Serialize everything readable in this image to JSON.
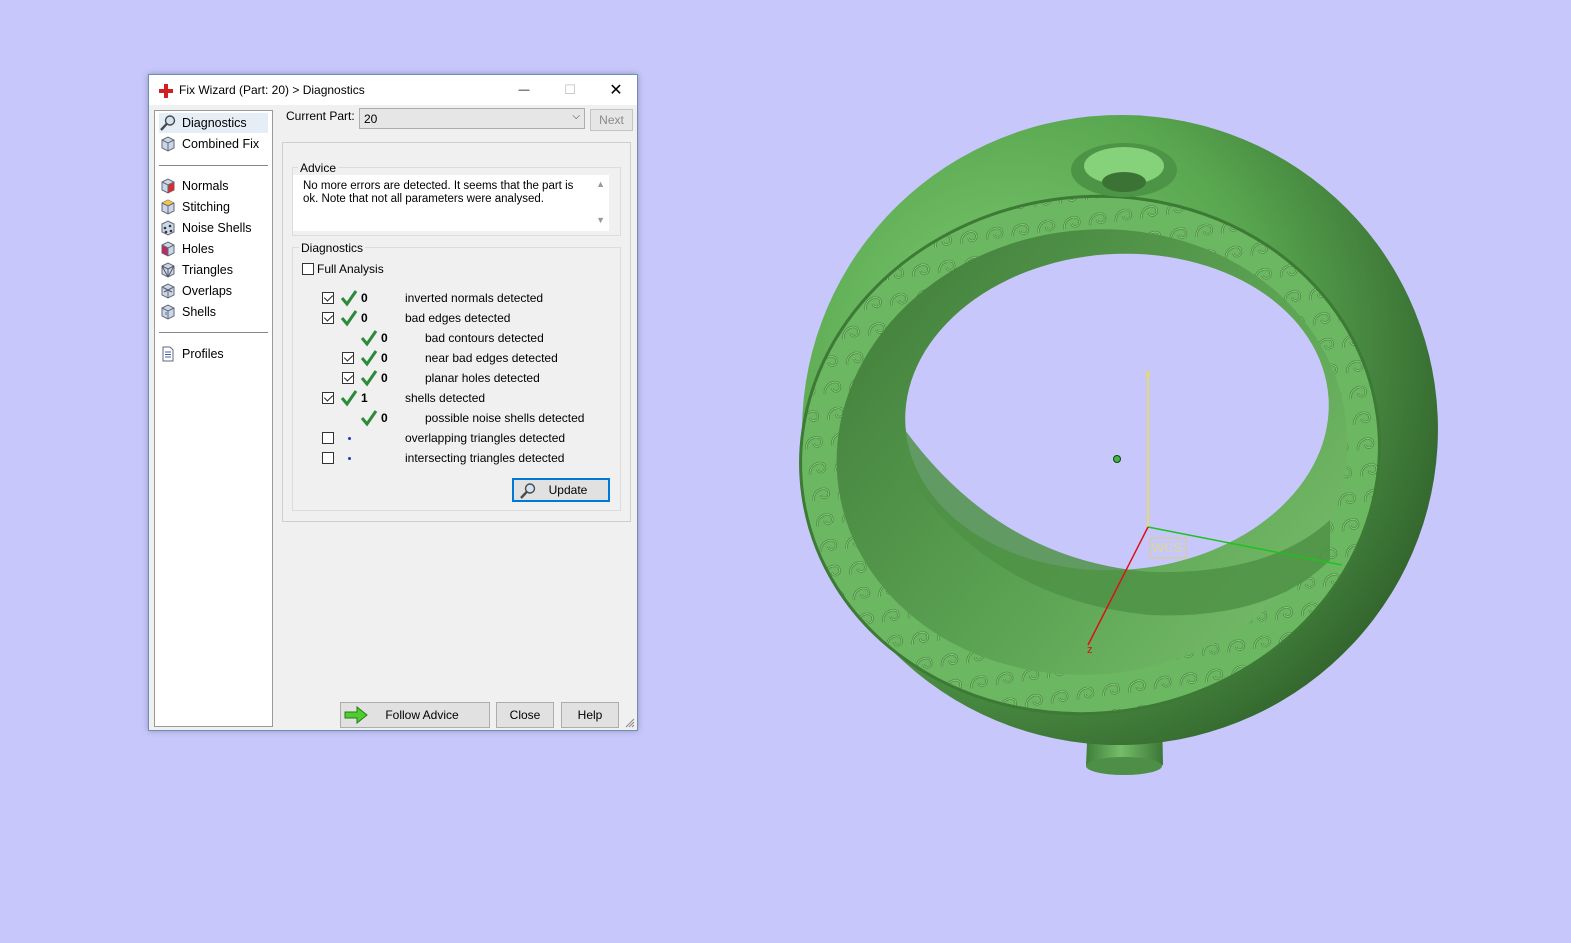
{
  "window": {
    "title": "Fix Wizard (Part: 20) > Diagnostics",
    "controls": {
      "minimize": "—",
      "maximize": "☐",
      "close": "✕"
    }
  },
  "nav": {
    "top": [
      {
        "label": "Diagnostics",
        "icon": "magnifier-icon",
        "selected": true
      },
      {
        "label": "Combined Fix",
        "icon": "cube-icon"
      }
    ],
    "tools": [
      {
        "label": "Normals",
        "icon": "normals-cube-icon"
      },
      {
        "label": "Stitching",
        "icon": "stitching-cube-icon"
      },
      {
        "label": "Noise Shells",
        "icon": "noise-shells-icon"
      },
      {
        "label": "Holes",
        "icon": "holes-cube-icon"
      },
      {
        "label": "Triangles",
        "icon": "triangles-cube-icon"
      },
      {
        "label": "Overlaps",
        "icon": "overlaps-cube-icon"
      },
      {
        "label": "Shells",
        "icon": "shells-cube-icon"
      }
    ],
    "bottom": [
      {
        "label": "Profiles",
        "icon": "document-icon"
      }
    ]
  },
  "current_part": {
    "label": "Current Part:",
    "value": "20",
    "next_label": "Next"
  },
  "advice": {
    "title": "Advice",
    "text": "No more errors are detected. It seems that the part is ok. Note that not all parameters were analysed."
  },
  "diagnostics": {
    "title": "Diagnostics",
    "full_analysis_label": "Full Analysis",
    "rows": [
      {
        "checked": true,
        "status": "ok",
        "count": "0",
        "label": "inverted normals detected"
      },
      {
        "checked": true,
        "status": "ok",
        "count": "0",
        "label": "bad edges detected"
      },
      {
        "checked": null,
        "status": "ok",
        "count": "0",
        "label": "bad contours detected"
      },
      {
        "checked": true,
        "status": "ok",
        "count": "0",
        "label": "near bad edges detected"
      },
      {
        "checked": true,
        "status": "ok",
        "count": "0",
        "label": "planar holes detected"
      },
      {
        "checked": true,
        "status": "ok",
        "count": "1",
        "label": "shells detected"
      },
      {
        "checked": null,
        "status": "ok",
        "count": "0",
        "label": "possible noise shells detected"
      },
      {
        "checked": false,
        "status": "none",
        "count": "",
        "label": "overlapping triangles detected"
      },
      {
        "checked": false,
        "status": "none",
        "count": "",
        "label": "intersecting triangles detected"
      }
    ],
    "update_label": "Update"
  },
  "footer": {
    "follow_advice_label": "Follow Advice",
    "close_label": "Close",
    "help_label": "Help"
  },
  "viewport": {
    "axis_labels": {
      "y": "y",
      "z": "z"
    },
    "wcs_label": "WCS",
    "model_color": "#5fa85a",
    "background": "#c7c7fb"
  }
}
